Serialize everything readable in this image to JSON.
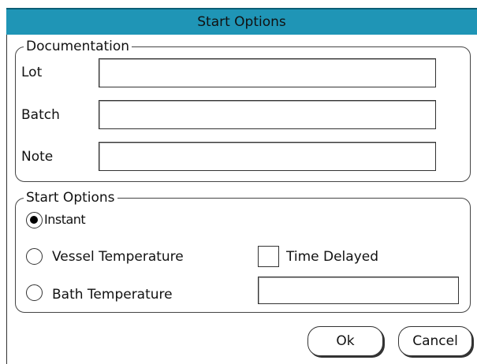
{
  "dialog": {
    "title": "Start Options"
  },
  "documentation": {
    "legend": "Documentation",
    "fields": [
      {
        "label": "Lot",
        "value": ""
      },
      {
        "label": "Batch",
        "value": ""
      },
      {
        "label": "Note",
        "value": ""
      }
    ]
  },
  "start_options": {
    "legend": "Start Options",
    "options": [
      {
        "label": "Instant",
        "selected": true
      },
      {
        "label": "Vessel Temperature",
        "selected": false
      },
      {
        "label": "Bath Temperature",
        "selected": false
      }
    ],
    "time_delayed": {
      "label": "Time Delayed",
      "checked": false
    },
    "bath_temperature_value": ""
  },
  "buttons": {
    "ok": "Ok",
    "cancel": "Cancel"
  }
}
